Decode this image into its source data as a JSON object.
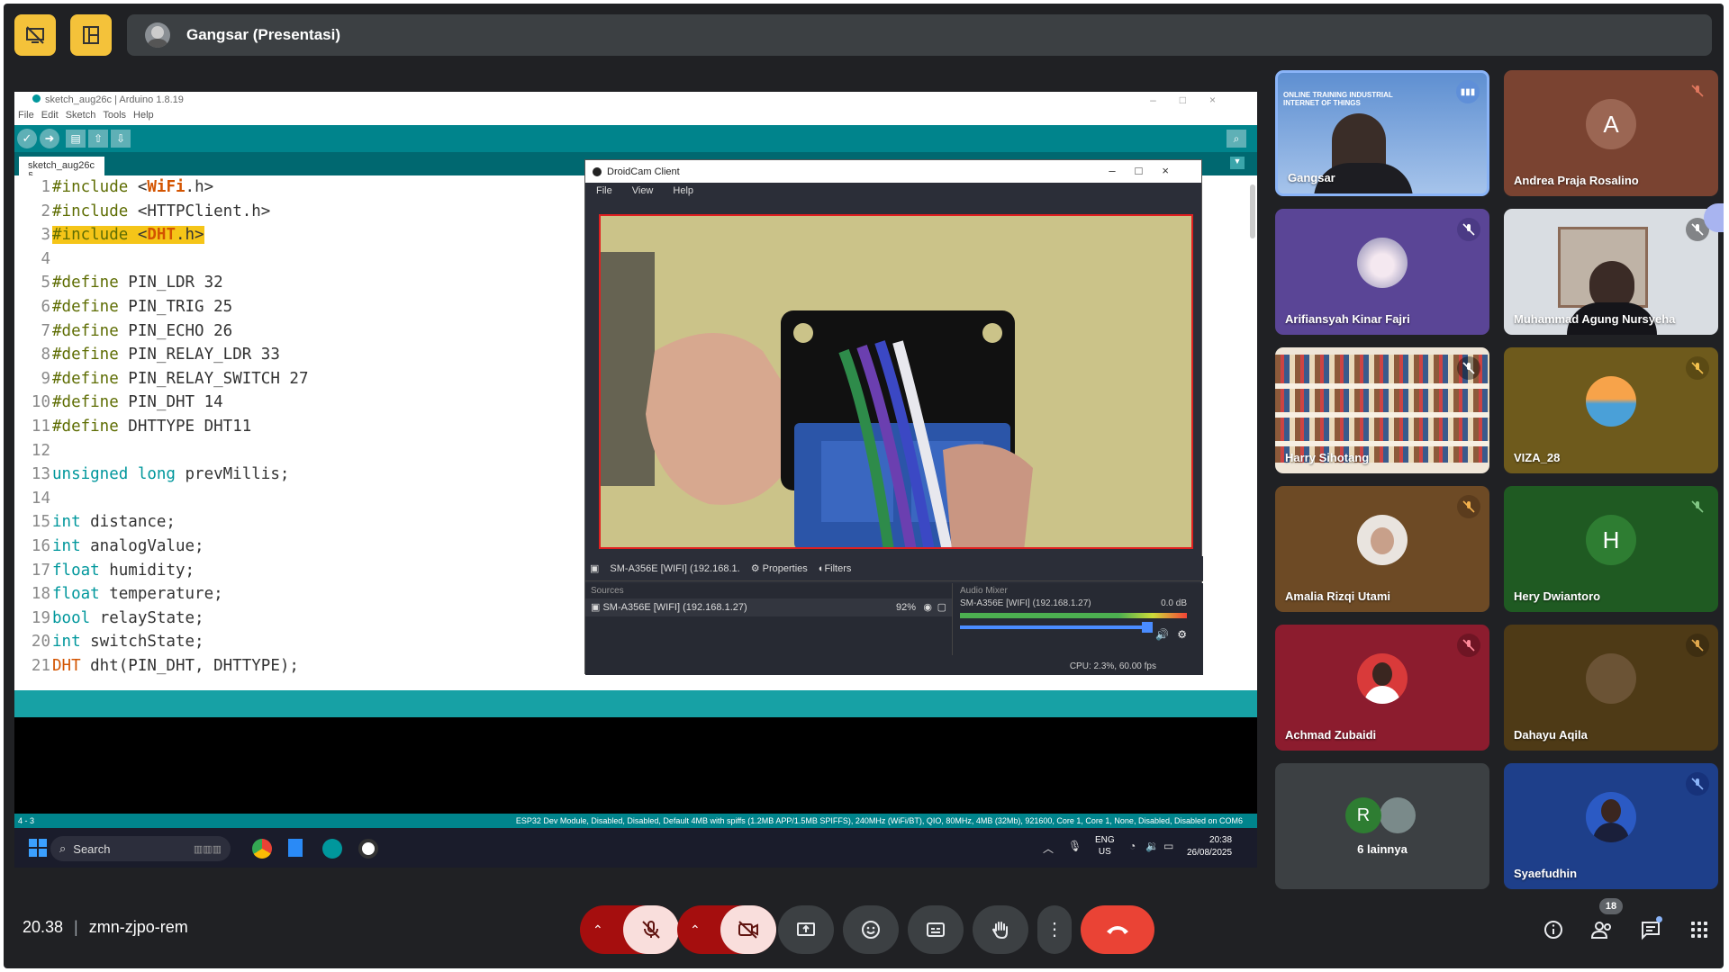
{
  "presenter": {
    "label": "Gangsar (Presentasi)"
  },
  "ide": {
    "window_title": "sketch_aug26c | Arduino 1.8.19",
    "menu": [
      "File",
      "Edit",
      "Sketch",
      "Tools",
      "Help"
    ],
    "tab_label": "sketch_aug26c §",
    "code_lines": [
      {
        "n": "1",
        "text": "#include <WiFi.h>"
      },
      {
        "n": "2",
        "text": "#include <HTTPClient.h>"
      },
      {
        "n": "3",
        "text": "#include <DHT.h>"
      },
      {
        "n": "4",
        "text": ""
      },
      {
        "n": "5",
        "text": "#define PIN_LDR 32"
      },
      {
        "n": "6",
        "text": "#define PIN_TRIG 25"
      },
      {
        "n": "7",
        "text": "#define PIN_ECHO 26"
      },
      {
        "n": "8",
        "text": "#define PIN_RELAY_LDR 33"
      },
      {
        "n": "9",
        "text": "#define PIN_RELAY_SWITCH 27"
      },
      {
        "n": "10",
        "text": "#define PIN_DHT 14"
      },
      {
        "n": "11",
        "text": "#define DHTTYPE DHT11"
      },
      {
        "n": "12",
        "text": ""
      },
      {
        "n": "13",
        "text": "unsigned long prevMillis;"
      },
      {
        "n": "14",
        "text": ""
      },
      {
        "n": "15",
        "text": "int distance;"
      },
      {
        "n": "16",
        "text": "int analogValue;"
      },
      {
        "n": "17",
        "text": "float humidity;"
      },
      {
        "n": "18",
        "text": "float temperature;"
      },
      {
        "n": "19",
        "text": "bool relayState;"
      },
      {
        "n": "20",
        "text": "int switchState;"
      },
      {
        "n": "21",
        "text": "DHT dht(PIN_DHT, DHTTYPE);"
      }
    ],
    "status_left": "4 - 3",
    "status_right": "ESP32 Dev Module, Disabled, Disabled, Default 4MB with spiffs (1.2MB APP/1.5MB SPIFFS), 240MHz (WiFi/BT), QIO, 80MHz, 4MB (32Mb), 921600, Core 1, Core 1, None, Disabled, Disabled on COM6"
  },
  "droidcam": {
    "title": "DroidCam Client",
    "menu": [
      "File",
      "View",
      "Help"
    ],
    "source_label": "SM-A356E [WIFI] (192.168.1.",
    "properties_label": "Properties",
    "filters_label": "Filters",
    "sources_header": "Sources",
    "source_item": "SM-A356E [WIFI] (192.168.1.27)",
    "battery": "92%",
    "mixer_header": "Audio Mixer",
    "mixer_item": "SM-A356E [WIFI] (192.168.1.27)",
    "mixer_db": "0.0 dB",
    "cpu": "CPU: 2.3%, 60.00 fps"
  },
  "taskbar": {
    "search_placeholder": "Search",
    "lang_top": "ENG",
    "lang_bottom": "US",
    "time": "20:38",
    "date": "26/08/2025"
  },
  "participants": [
    {
      "name": "Gangsar"
    },
    {
      "name": "Andrea Praja Rosalino",
      "initial": "A"
    },
    {
      "name": "Arifiansyah Kinar Fajri"
    },
    {
      "name": "Muhammad Agung Nursyeha"
    },
    {
      "name": "Harry Sihotang"
    },
    {
      "name": "VIZA_28"
    },
    {
      "name": "Amalia Rizqi Utami"
    },
    {
      "name": "Hery Dwiantoro",
      "initial": "H"
    },
    {
      "name": "Achmad Zubaidi"
    },
    {
      "name": "Dahayu Aqila"
    },
    {
      "name": "6 lainnya",
      "initial": "R"
    },
    {
      "name": "Syaefudhin"
    }
  ],
  "presenter_banner": "ONLINE TRAINING INDUSTRIAL INTERNET OF THINGS",
  "meeting": {
    "time": "20.38",
    "code": "zmn-zjpo-rem"
  },
  "people_count": "18",
  "colors": {
    "accent_yellow": "#f4c23a",
    "end_call": "#ea4335",
    "arduino_teal": "#00848c"
  }
}
